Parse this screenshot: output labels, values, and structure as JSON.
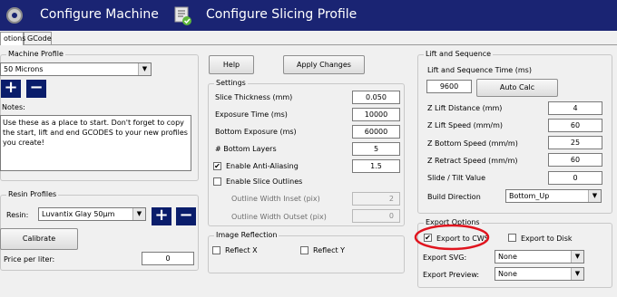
{
  "banner": {
    "machine_title": "Configure Machine",
    "slicing_title": "Configure Slicing Profile",
    "color": "#1a2473"
  },
  "tabs": [
    "otions",
    "GCode"
  ],
  "machine_profile": {
    "legend": "Machine Profile",
    "selected": "50 Microns",
    "add": "+",
    "remove": "−",
    "notes_label": "Notes:",
    "notes": "Use these as a place to start. Don't forget to copy the start, lift and end GCODES to your new profiles you create!"
  },
  "resin_profiles": {
    "legend": "Resin Profiles",
    "resin_label": "Resin:",
    "resin_selected": "Luvantix Glay 50µm",
    "add": "+",
    "remove": "−",
    "calibrate": "Calibrate",
    "price_label": "Price per liter:",
    "price": "0"
  },
  "actions": {
    "help": "Help",
    "apply": "Apply Changes"
  },
  "settings": {
    "legend": "Settings",
    "slice_thickness_label": "Slice Thickness (mm)",
    "slice_thickness": "0.050",
    "exposure_label": "Exposure Time (ms)",
    "exposure": "10000",
    "bottom_exposure_label": "Bottom Exposure (ms)",
    "bottom_exposure": "60000",
    "bottom_layers_label": "# Bottom Layers",
    "bottom_layers": "5",
    "anti_alias_label": "Enable Anti-Aliasing",
    "anti_alias_checked": true,
    "anti_alias_value": "1.5",
    "outlines_label": "Enable Slice Outlines",
    "outlines_checked": false,
    "inset_label": "Outline Width Inset (pix)",
    "inset": "2",
    "outset_label": "Outline Width Outset (pix)",
    "outset": "0"
  },
  "image_reflection": {
    "legend": "Image Reflection",
    "reflect_x": "Reflect X",
    "reflect_y": "Reflect Y"
  },
  "lift_sequence": {
    "legend": "Lift and Sequence",
    "time_label": "Lift and Sequence Time (ms)",
    "time": "9600",
    "auto_calc": "Auto Calc",
    "lift_distance_label": "Z Lift Distance (mm)",
    "lift_distance": "4",
    "lift_speed_label": "Z Lift Speed (mm/m)",
    "lift_speed": "60",
    "bottom_speed_label": "Z Bottom Speed (mm/m)",
    "bottom_speed": "25",
    "retract_speed_label": "Z Retract Speed (mm/m)",
    "retract_speed": "60",
    "slide_tilt_label": "Slide / Tilt Value",
    "slide_tilt": "0",
    "build_direction_label": "Build Direction",
    "build_direction": "Bottom_Up"
  },
  "export_options": {
    "legend": "Export Options",
    "to_cws": "Export to CWS",
    "to_cws_checked": true,
    "to_disk": "Export to Disk",
    "to_disk_checked": false,
    "svg_label": "Export SVG:",
    "svg": "None",
    "preview_label": "Export Preview:",
    "preview": "None",
    "highlight_color": "#e0141e"
  }
}
